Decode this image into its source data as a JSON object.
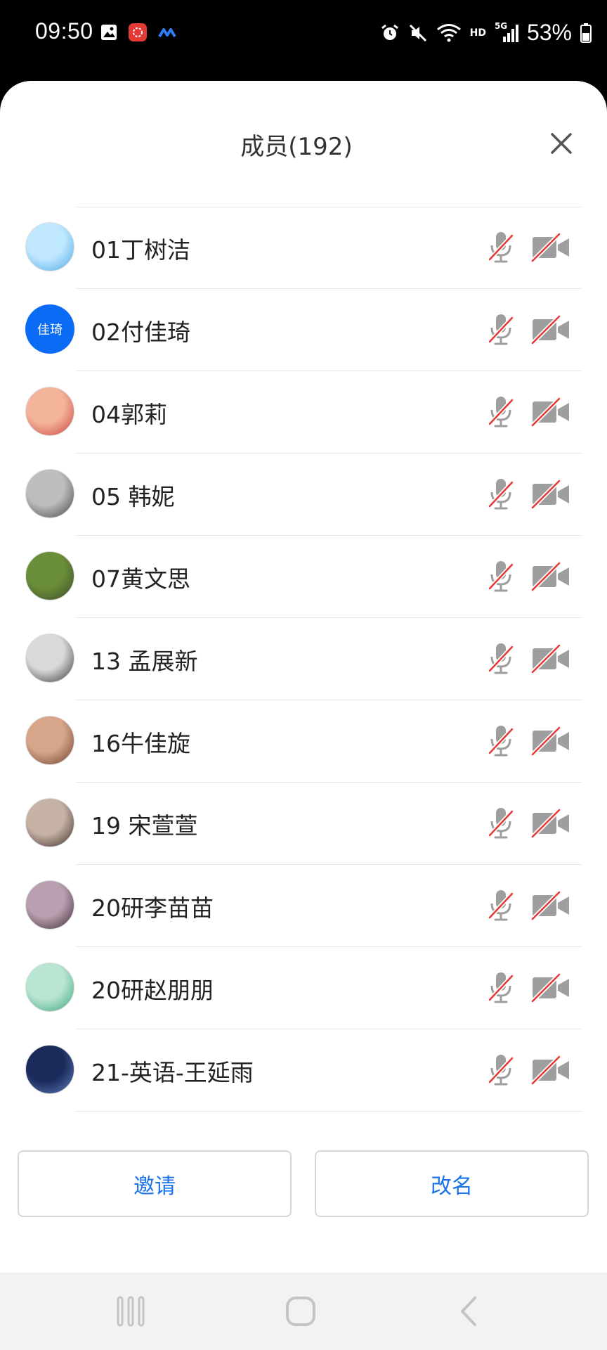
{
  "status_bar": {
    "time": "09:50",
    "network": "HD",
    "signal": "5G",
    "battery": "53%",
    "left_icons": [
      "gallery-icon",
      "app-notification-icon",
      "app-notification-icon"
    ],
    "right_icons": [
      "alarm-icon",
      "mute-icon",
      "wifi-icon",
      "signal-icon",
      "battery-icon"
    ]
  },
  "sheet": {
    "title": "成员(192)"
  },
  "members": [
    {
      "name": "01丁树洁",
      "avatar": "image"
    },
    {
      "name": "02付佳琦",
      "avatar": "text",
      "avatar_text": "佳琦"
    },
    {
      "name": "04郭莉",
      "avatar": "image"
    },
    {
      "name": "05 韩妮",
      "avatar": "image"
    },
    {
      "name": "07黄文思",
      "avatar": "image"
    },
    {
      "name": "13 孟展新",
      "avatar": "image"
    },
    {
      "name": "16牛佳旋",
      "avatar": "image"
    },
    {
      "name": "19 宋萱萱",
      "avatar": "image"
    },
    {
      "name": "20研李苗苗",
      "avatar": "image"
    },
    {
      "name": "20研赵朋朋",
      "avatar": "image"
    },
    {
      "name": "21-英语-王延雨",
      "avatar": "image"
    }
  ],
  "buttons": {
    "invite": "邀请",
    "rename": "改名"
  },
  "colors": {
    "accent": "#1a73e8",
    "avatar_blue": "#0a6cf5",
    "mute_red": "#e53935",
    "icon_gray": "#9e9e9e"
  }
}
